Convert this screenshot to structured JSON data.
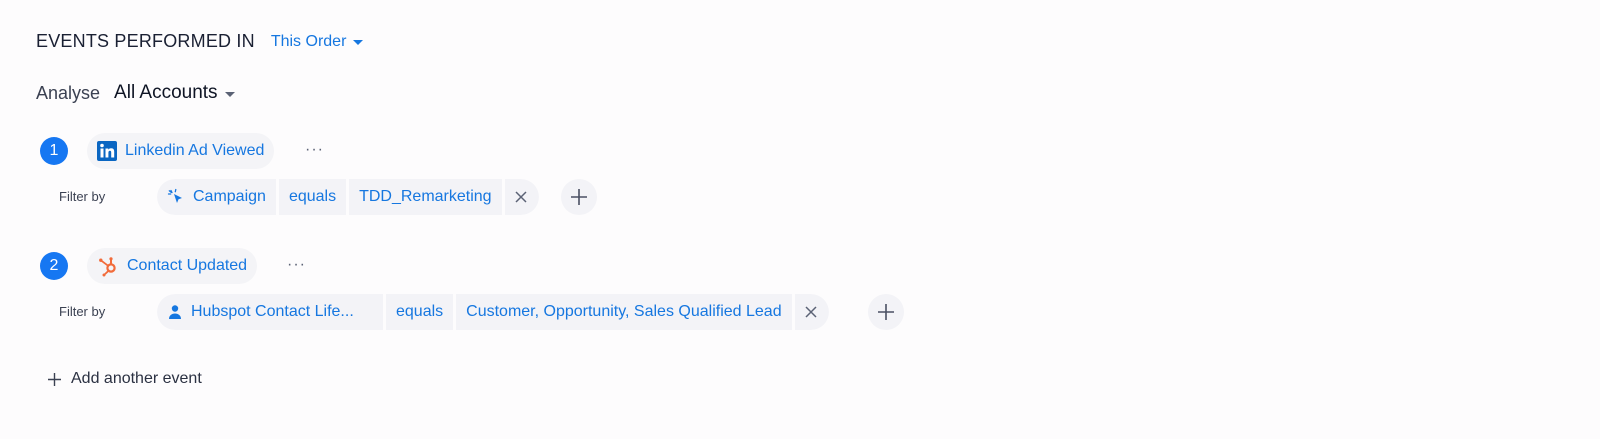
{
  "header": {
    "title": "EVENTS PERFORMED IN",
    "scope": "This Order"
  },
  "analyse": {
    "label": "Analyse",
    "value": "All Accounts"
  },
  "events": [
    {
      "number": "1",
      "name": "Linkedin Ad Viewed",
      "icon": "linkedin-icon",
      "more": "···",
      "filter_label": "Filter by",
      "filter": {
        "property": "Campaign",
        "property_icon": "cursor-click-icon",
        "operator": "equals",
        "value": "TDD_Remarketing"
      }
    },
    {
      "number": "2",
      "name": "Contact Updated",
      "icon": "hubspot-icon",
      "more": "···",
      "filter_label": "Filter by",
      "filter": {
        "property": "Hubspot Contact Life...",
        "property_icon": "user-icon",
        "operator": "equals",
        "value": "Customer, Opportunity, Sales Qualified Lead"
      }
    }
  ],
  "add_event_label": "Add another event",
  "colors": {
    "accent": "#1677e0",
    "badge": "#1677f2",
    "pill_bg": "#f3f3f7",
    "hubspot": "#f26b3a",
    "linkedin": "#0a66c2"
  }
}
